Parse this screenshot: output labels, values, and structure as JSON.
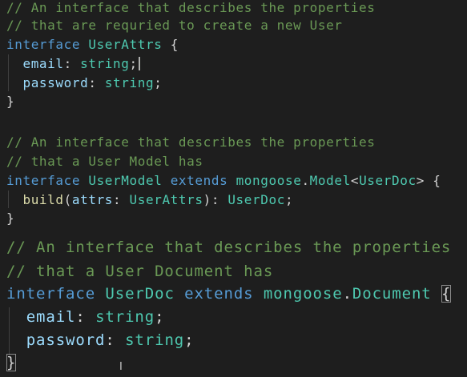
{
  "editor": {
    "block1": {
      "comment1": "// An interface that describes the properties",
      "comment2": "// that are requried to create a new User",
      "kw_interface": "interface",
      "name": "UserAttrs",
      "open": "{",
      "p1_name": "email",
      "p1_colon": ":",
      "p1_type": "string",
      "p1_semi": ";",
      "p2_name": "password",
      "p2_colon": ":",
      "p2_type": "string",
      "p2_semi": ";",
      "close": "}"
    },
    "block2": {
      "comment1": "// An interface that describes the properties",
      "comment2": "// that a User Model has",
      "kw_interface": "interface",
      "name": "UserModel",
      "kw_extends": "extends",
      "ns": "mongoose",
      "dot": ".",
      "base": "Model",
      "lt": "<",
      "generic": "UserDoc",
      "gt": ">",
      "open": "{",
      "method": "build",
      "paren_open": "(",
      "param": "attrs",
      "param_colon": ":",
      "param_type": "UserAttrs",
      "paren_close": ")",
      "ret_colon": ":",
      "ret_type": "UserDoc",
      "ret_semi": ";",
      "close": "}"
    },
    "block3": {
      "comment1": "// An interface that describes the properties",
      "comment2": "// that a User Document has",
      "kw_interface": "interface",
      "name": "UserDoc",
      "kw_extends": "extends",
      "ns": "mongoose",
      "dot": ".",
      "base": "Document",
      "open": "{",
      "p1_name": "email",
      "p1_colon": ":",
      "p1_type": "string",
      "p1_semi": ";",
      "p2_name": "password",
      "p2_colon": ":",
      "p2_type": "string",
      "p2_semi": ";",
      "close": "}"
    }
  },
  "colors": {
    "background": "#1e1e1e",
    "comment": "#6a9955",
    "keyword": "#569cd6",
    "type": "#4ec9b0",
    "property": "#9cdcfe",
    "function": "#dcdcaa",
    "punctuation": "#d4d4d4"
  },
  "cursor_icon": "i-beam-icon",
  "text_cursor": "text-caret"
}
